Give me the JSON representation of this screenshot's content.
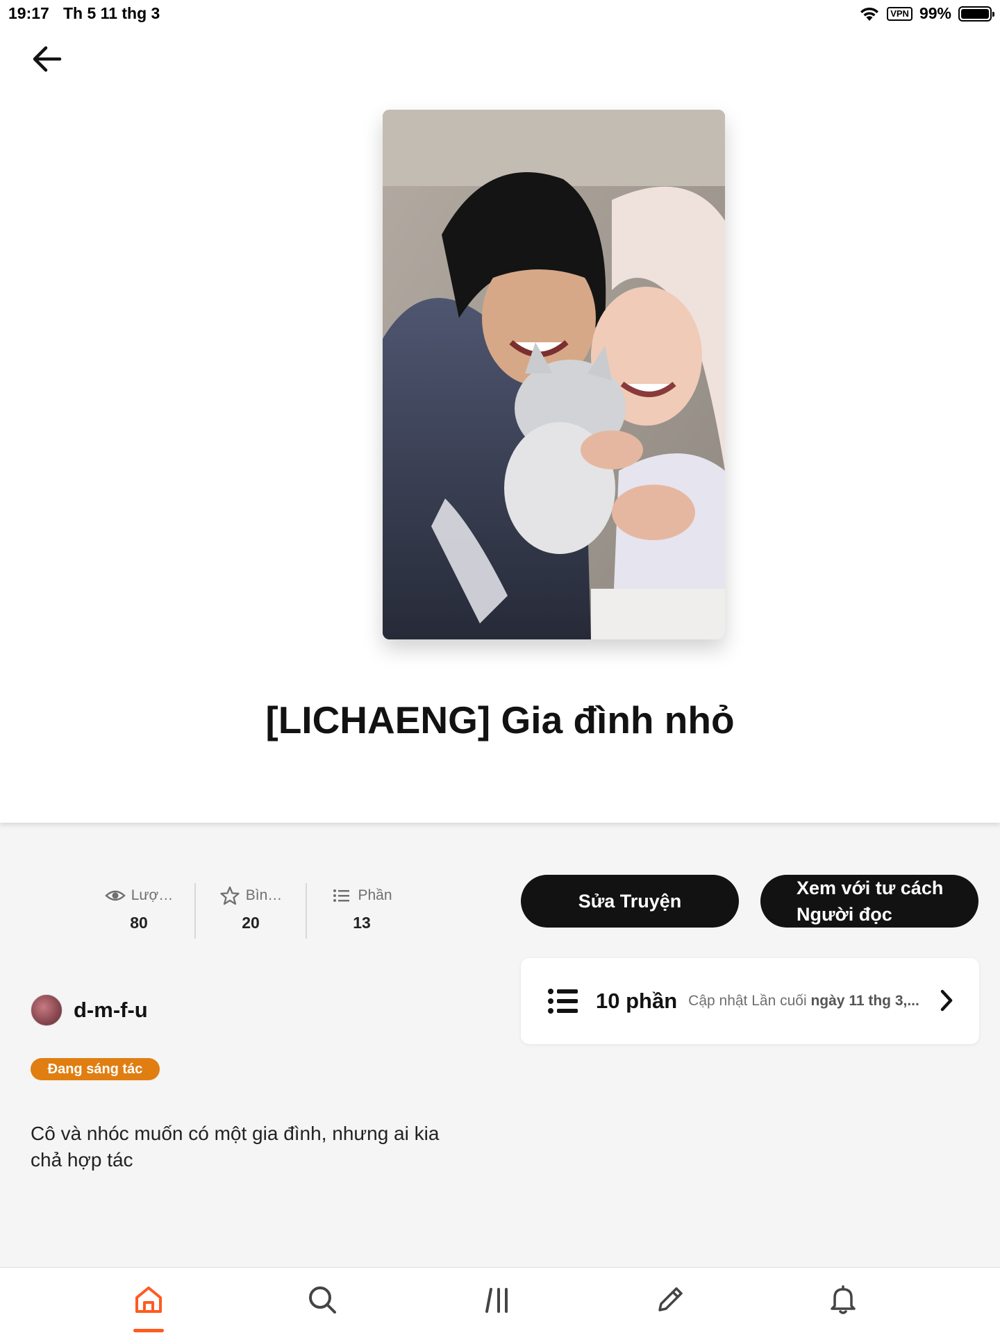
{
  "status_bar": {
    "time": "19:17",
    "date": "Th 5 11 thg 3",
    "vpn": "VPN",
    "battery": "99%"
  },
  "story": {
    "title": "[LICHAENG] Gia đình nhỏ",
    "cover_image": "photo-of-two-women-hugging-grey-cat"
  },
  "stats": [
    {
      "icon": "eye-icon",
      "label": "Lượ…",
      "value": "80"
    },
    {
      "icon": "star-icon",
      "label": "Bìn…",
      "value": "20"
    },
    {
      "icon": "list-icon",
      "label": "Phần",
      "value": "13"
    }
  ],
  "actions": {
    "edit_story": "Sửa Truyện",
    "view_as_reader_line1": "Xem với tư cách",
    "view_as_reader_line2": "Người đọc"
  },
  "parts": {
    "count": "10 phần",
    "updated_prefix": "Cập nhật Lần cuối",
    "updated_date": "ngày 11 thg 3,..."
  },
  "author": {
    "name": "d-m-f-u"
  },
  "status_badge": "Đang sáng tác",
  "description": "Cô và nhóc muốn có một gia đình, nhưng ai kia chả hợp tác",
  "tabs": [
    "home",
    "search",
    "library",
    "write",
    "notifications"
  ],
  "colors": {
    "accent": "#ff5a1f",
    "badge": "#e07e11",
    "button": "#121212"
  }
}
